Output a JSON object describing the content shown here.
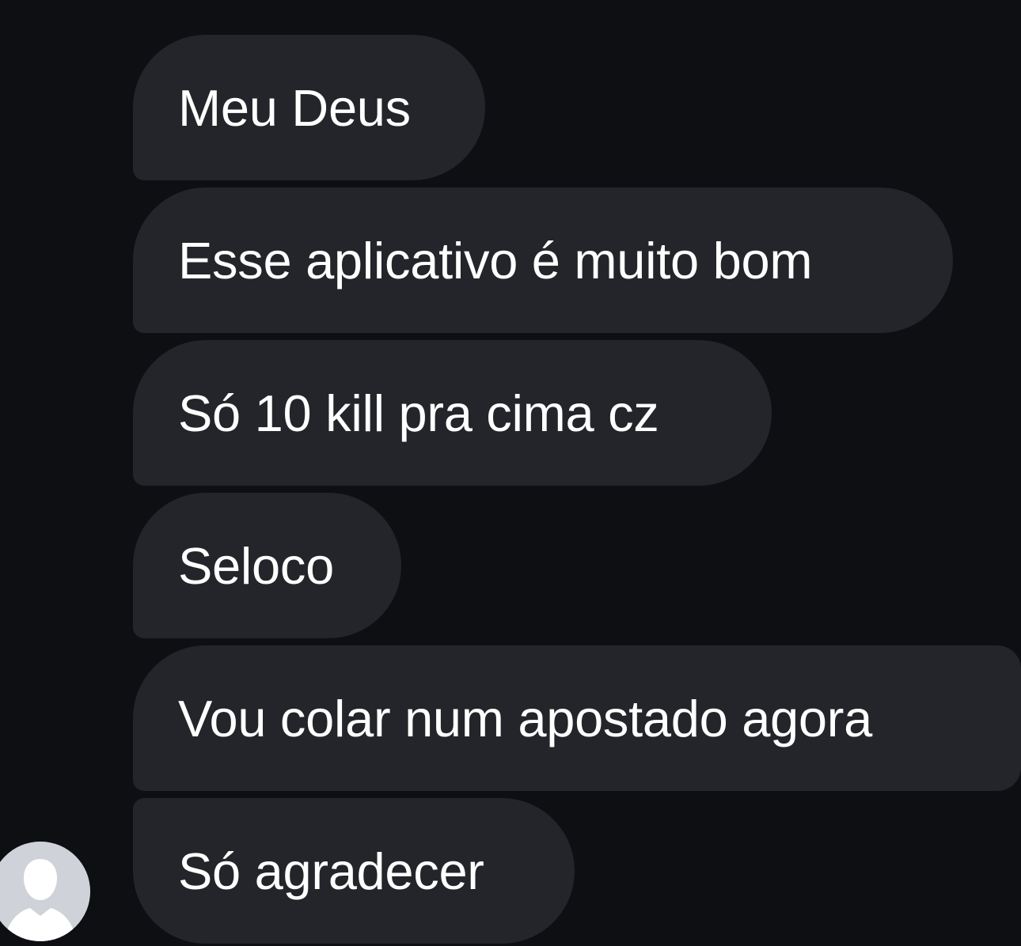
{
  "colors": {
    "background": "#0d0f13",
    "bubble": "#23252a",
    "text": "#ffffff",
    "avatar_bg": "#cfd2d8"
  },
  "sender": {
    "avatar_icon": "default-user-avatar-icon"
  },
  "messages": [
    {
      "text": "Meu Deus"
    },
    {
      "text": "Esse aplicativo é muito bom"
    },
    {
      "text": "Só 10 kill pra cima cz"
    },
    {
      "text": "Seloco"
    },
    {
      "text": "Vou colar num apostado agora"
    },
    {
      "text": "Só agradecer"
    }
  ]
}
